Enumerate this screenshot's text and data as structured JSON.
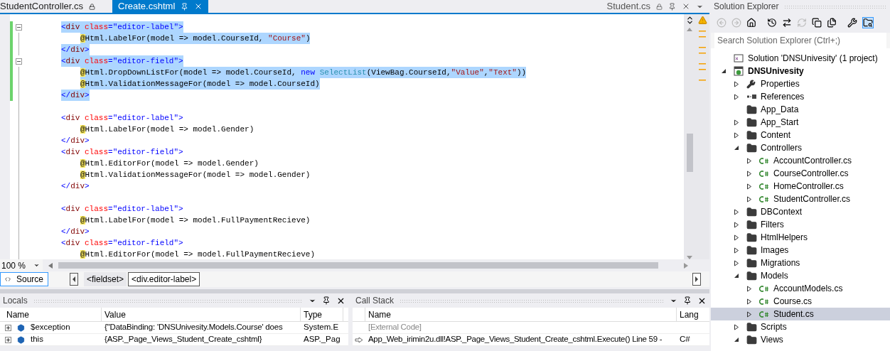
{
  "editor_tabs": [
    {
      "label": "StudentController.cs",
      "selected": false,
      "locked": true
    },
    {
      "label": "Create.cshtml",
      "selected": true,
      "locked": false
    }
  ],
  "preview_tab": {
    "label": "Student.cs",
    "locked": true
  },
  "code_lines": [
    {
      "kind": "markup",
      "selected": true,
      "modified": true,
      "collapsible": true,
      "tokens": [
        {
          "kind": "delim",
          "text": "<"
        },
        {
          "kind": "tag",
          "text": "div"
        },
        {
          "kind": "attr",
          "text": " class"
        },
        {
          "kind": "delim",
          "text": "="
        },
        {
          "kind": "value",
          "text": "\"editor-label\""
        },
        {
          "kind": "delim",
          "text": ">"
        }
      ]
    },
    {
      "kind": "razor",
      "selected": true,
      "modified": true,
      "collapsible": false,
      "tokens": [
        {
          "kind": "razor",
          "text": "@"
        },
        {
          "kind": "plain",
          "text": "Html.LabelFor(model => model.CourseId, "
        },
        {
          "kind": "string",
          "text": "\"Course\""
        },
        {
          "kind": "plain",
          "text": ")"
        }
      ]
    },
    {
      "kind": "markup",
      "selected": true,
      "modified": true,
      "collapsible": false,
      "tokens": [
        {
          "kind": "delim",
          "text": "</"
        },
        {
          "kind": "tag",
          "text": "div"
        },
        {
          "kind": "delim",
          "text": ">"
        }
      ]
    },
    {
      "kind": "markup",
      "selected": true,
      "modified": true,
      "collapsible": true,
      "tokens": [
        {
          "kind": "delim",
          "text": "<"
        },
        {
          "kind": "tag",
          "text": "div"
        },
        {
          "kind": "attr",
          "text": " class"
        },
        {
          "kind": "delim",
          "text": "="
        },
        {
          "kind": "value",
          "text": "\"editor-field\""
        },
        {
          "kind": "delim",
          "text": ">"
        }
      ]
    },
    {
      "kind": "razor",
      "selected": true,
      "modified": true,
      "collapsible": false,
      "tokens": [
        {
          "kind": "razor",
          "text": "@"
        },
        {
          "kind": "plain",
          "text": "Html.DropDownListFor(model => model.CourseId, "
        },
        {
          "kind": "keyword",
          "text": "new"
        },
        {
          "kind": "type",
          "text": " SelectList"
        },
        {
          "kind": "plain",
          "text": "(ViewBag.CourseId,"
        },
        {
          "kind": "string",
          "text": "\"Value\""
        },
        {
          "kind": "plain",
          "text": ","
        },
        {
          "kind": "string",
          "text": "\"Text\""
        },
        {
          "kind": "plain",
          "text": "))"
        }
      ]
    },
    {
      "kind": "razor",
      "selected": true,
      "modified": true,
      "collapsible": false,
      "tokens": [
        {
          "kind": "razor",
          "text": "@"
        },
        {
          "kind": "plain",
          "text": "Html.ValidationMessageFor(model => model.CourseId)"
        }
      ]
    },
    {
      "kind": "markup",
      "selected": true,
      "modified": true,
      "collapsible": false,
      "tokens": [
        {
          "kind": "delim",
          "text": "</"
        },
        {
          "kind": "tag",
          "text": "div"
        },
        {
          "kind": "delim",
          "text": ">"
        }
      ]
    },
    {
      "modified": false
    },
    {
      "kind": "markup",
      "selected": false,
      "modified": false,
      "collapsible": false,
      "tokens": [
        {
          "kind": "delim",
          "text": "<"
        },
        {
          "kind": "tag",
          "text": "div"
        },
        {
          "kind": "attr",
          "text": " class"
        },
        {
          "kind": "delim",
          "text": "="
        },
        {
          "kind": "value",
          "text": "\"editor-label\""
        },
        {
          "kind": "delim",
          "text": ">"
        }
      ]
    },
    {
      "kind": "razor",
      "selected": false,
      "modified": false,
      "collapsible": false,
      "tokens": [
        {
          "kind": "razor",
          "text": "@"
        },
        {
          "kind": "plain",
          "text": "Html.LabelFor(model => model.Gender)"
        }
      ]
    },
    {
      "kind": "markup",
      "selected": false,
      "modified": false,
      "collapsible": false,
      "tokens": [
        {
          "kind": "delim",
          "text": "</"
        },
        {
          "kind": "tag",
          "text": "div"
        },
        {
          "kind": "delim",
          "text": ">"
        }
      ]
    },
    {
      "kind": "markup",
      "selected": false,
      "modified": false,
      "collapsible": false,
      "tokens": [
        {
          "kind": "delim",
          "text": "<"
        },
        {
          "kind": "tag",
          "text": "div"
        },
        {
          "kind": "attr",
          "text": " class"
        },
        {
          "kind": "delim",
          "text": "="
        },
        {
          "kind": "value",
          "text": "\"editor-field\""
        },
        {
          "kind": "delim",
          "text": ">"
        }
      ]
    },
    {
      "kind": "razor",
      "selected": false,
      "modified": false,
      "collapsible": false,
      "tokens": [
        {
          "kind": "razor",
          "text": "@"
        },
        {
          "kind": "plain",
          "text": "Html.EditorFor(model => model.Gender)"
        }
      ]
    },
    {
      "kind": "razor",
      "selected": false,
      "modified": false,
      "collapsible": false,
      "tokens": [
        {
          "kind": "razor",
          "text": "@"
        },
        {
          "kind": "plain",
          "text": "Html.ValidationMessageFor(model => model.Gender)"
        }
      ]
    },
    {
      "kind": "markup",
      "selected": false,
      "modified": false,
      "collapsible": false,
      "tokens": [
        {
          "kind": "delim",
          "text": "</"
        },
        {
          "kind": "tag",
          "text": "div"
        },
        {
          "kind": "delim",
          "text": ">"
        }
      ]
    },
    {
      "modified": false
    },
    {
      "kind": "markup",
      "selected": false,
      "modified": false,
      "collapsible": false,
      "tokens": [
        {
          "kind": "delim",
          "text": "<"
        },
        {
          "kind": "tag",
          "text": "div"
        },
        {
          "kind": "attr",
          "text": " class"
        },
        {
          "kind": "delim",
          "text": "="
        },
        {
          "kind": "value",
          "text": "\"editor-label\""
        },
        {
          "kind": "delim",
          "text": ">"
        }
      ]
    },
    {
      "kind": "razor",
      "selected": false,
      "modified": false,
      "collapsible": false,
      "tokens": [
        {
          "kind": "razor",
          "text": "@"
        },
        {
          "kind": "plain",
          "text": "Html.LabelFor(model => model.FullPaymentRecieve)"
        }
      ]
    },
    {
      "kind": "markup",
      "selected": false,
      "modified": false,
      "collapsible": false,
      "tokens": [
        {
          "kind": "delim",
          "text": "</"
        },
        {
          "kind": "tag",
          "text": "div"
        },
        {
          "kind": "delim",
          "text": ">"
        }
      ]
    },
    {
      "kind": "markup",
      "selected": false,
      "modified": false,
      "collapsible": false,
      "tokens": [
        {
          "kind": "delim",
          "text": "<"
        },
        {
          "kind": "tag",
          "text": "div"
        },
        {
          "kind": "attr",
          "text": " class"
        },
        {
          "kind": "delim",
          "text": "="
        },
        {
          "kind": "value",
          "text": "\"editor-field\""
        },
        {
          "kind": "delim",
          "text": ">"
        }
      ]
    },
    {
      "kind": "razor",
      "selected": false,
      "modified": false,
      "collapsible": false,
      "tokens": [
        {
          "kind": "razor",
          "text": "@"
        },
        {
          "kind": "plain",
          "text": "Html.EditorFor(model => model.FullPaymentRecieve)"
        }
      ]
    }
  ],
  "zoom": {
    "value": "100 %"
  },
  "view_tabs": [
    {
      "label": "Source",
      "selected": true
    }
  ],
  "breadcrumbs": [
    {
      "label": "<fieldset>",
      "selected": false
    },
    {
      "label": "<div.editor-label>",
      "selected": true
    }
  ],
  "locals": {
    "title": "Locals",
    "columns": [
      "Name",
      "Value",
      "Type"
    ],
    "rows": [
      {
        "expanded": false,
        "cells": [
          "$exception",
          "{\"DataBinding: 'DNSUnivesity.Models.Course' does",
          "System.E"
        ]
      },
      {
        "expanded": false,
        "cells": [
          "this",
          "{ASP._Page_Views_Student_Create_cshtml}",
          "ASP._Pag"
        ]
      }
    ]
  },
  "call_stack": {
    "title": "Call Stack",
    "columns": [
      "Name",
      "Lang"
    ],
    "rows": [
      {
        "current": false,
        "external": true,
        "name": "[External Code]"
      },
      {
        "current": true,
        "external": false,
        "name": "App_Web_irimin2u.dll!ASP._Page_Views_Student_Create_cshtml.Execute() Line 59 -",
        "lang": "C#"
      }
    ]
  },
  "solution_explorer": {
    "title": "Solution Explorer",
    "search": {
      "placeholder": "Search Solution Explorer (Ctrl+;)"
    },
    "tree": [
      {
        "label": "Solution 'DNSUnivesity' (1 project)",
        "kind": "solution",
        "selected": false
      },
      {
        "label": "DNSUnivesity",
        "kind": "project",
        "selected": false,
        "expanded": true,
        "children": [
          {
            "label": "Properties",
            "kind": "properties",
            "selected": false,
            "expanded": false
          },
          {
            "label": "References",
            "kind": "references",
            "selected": false,
            "expanded": false
          },
          {
            "label": "App_Data",
            "kind": "folder",
            "selected": false
          },
          {
            "label": "App_Start",
            "kind": "folder",
            "selected": false,
            "expanded": false
          },
          {
            "label": "Content",
            "kind": "folder",
            "selected": false,
            "expanded": false
          },
          {
            "label": "Controllers",
            "kind": "folder",
            "selected": false,
            "expanded": true,
            "children": [
              {
                "label": "AccountController.cs",
                "kind": "csharp",
                "selected": false,
                "expanded": false
              },
              {
                "label": "CourseController.cs",
                "kind": "csharp",
                "selected": false,
                "expanded": false
              },
              {
                "label": "HomeController.cs",
                "kind": "csharp",
                "selected": false,
                "expanded": false
              },
              {
                "label": "StudentController.cs",
                "kind": "csharp",
                "selected": false,
                "expanded": false
              }
            ]
          },
          {
            "label": "DBContext",
            "kind": "folder",
            "selected": false,
            "expanded": false
          },
          {
            "label": "Filters",
            "kind": "folder",
            "selected": false,
            "expanded": false
          },
          {
            "label": "HtmlHelpers",
            "kind": "folder",
            "selected": false,
            "expanded": false
          },
          {
            "label": "Images",
            "kind": "folder",
            "selected": false,
            "expanded": false
          },
          {
            "label": "Migrations",
            "kind": "folder",
            "selected": false,
            "expanded": false
          },
          {
            "label": "Models",
            "kind": "folder",
            "selected": false,
            "expanded": true,
            "children": [
              {
                "label": "AccountModels.cs",
                "kind": "csharp",
                "selected": false,
                "expanded": false
              },
              {
                "label": "Course.cs",
                "kind": "csharp",
                "selected": false,
                "expanded": false
              },
              {
                "label": "Student.cs",
                "kind": "csharp",
                "selected": true,
                "expanded": false
              }
            ]
          },
          {
            "label": "Scripts",
            "kind": "folder",
            "selected": false,
            "expanded": false
          },
          {
            "label": "Views",
            "kind": "folder",
            "selected": false,
            "expanded": true
          }
        ]
      }
    ]
  }
}
